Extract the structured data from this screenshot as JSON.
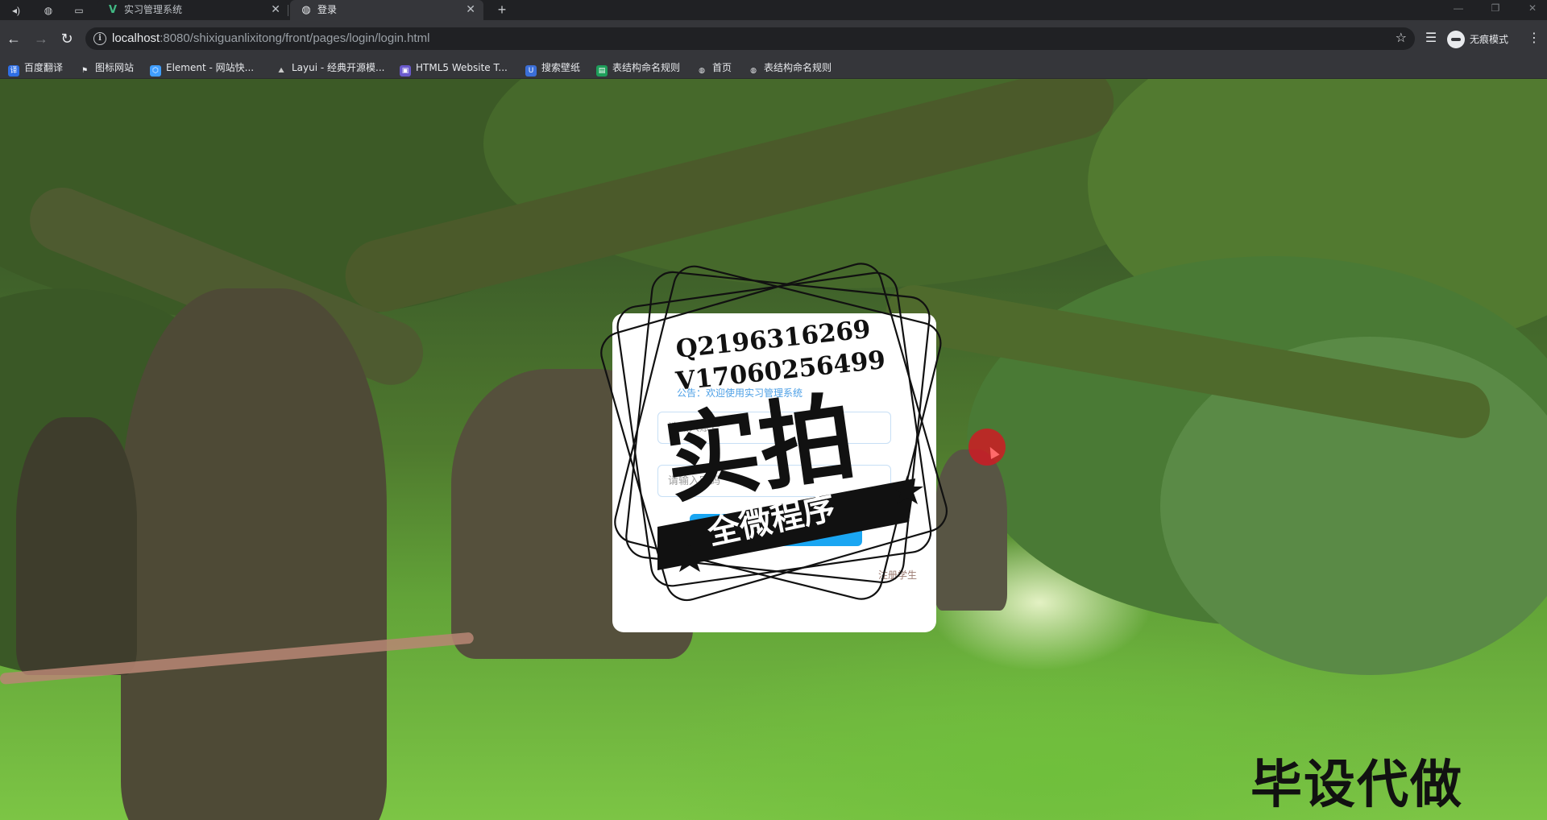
{
  "browser": {
    "tabs": [
      {
        "title": "实习管理系统",
        "favicon": "vue-logo",
        "active": false
      },
      {
        "title": "登录",
        "favicon": "globe-icon",
        "active": true
      }
    ],
    "url_host": "localhost",
    "url_rest": ":8080/shixiguanlixitong/front/pages/login/login.html",
    "incognito_label": "无痕模式",
    "bookmarks": [
      {
        "label": "百度翻译",
        "icon": "baidu-translate-icon",
        "color": "#2f6fe4"
      },
      {
        "label": "图标网站",
        "icon": "flag-icon",
        "color": "#e8eaed"
      },
      {
        "label": "Element - 网站快...",
        "icon": "element-icon",
        "color": "#409eff"
      },
      {
        "label": "Layui - 经典开源模...",
        "icon": "layui-icon",
        "color": "#9aa0a6"
      },
      {
        "label": "HTML5 Website T...",
        "icon": "html5-icon",
        "color": "#6a5acd"
      },
      {
        "label": "搜索壁纸",
        "icon": "wallpaper-icon",
        "color": "#4c8bf5"
      },
      {
        "label": "表结构命名规则",
        "icon": "sheet-icon",
        "color": "#1e9e5a"
      },
      {
        "label": "首页",
        "icon": "globe-icon",
        "color": "#e8eaed"
      },
      {
        "label": "表结构命名规则",
        "icon": "globe-icon",
        "color": "#e8eaed"
      }
    ]
  },
  "login": {
    "notice": "公告：欢迎使用实习管理系统",
    "username_placeholder": "请输入账号",
    "password_placeholder": "请输入密码",
    "login_button": "登录",
    "register_link": "注册学生"
  },
  "watermark": {
    "line1": "Q2196316269",
    "line2": "V17060256499",
    "big": "实拍",
    "ribbon": "全微程序",
    "bottom": "毕设代做"
  }
}
